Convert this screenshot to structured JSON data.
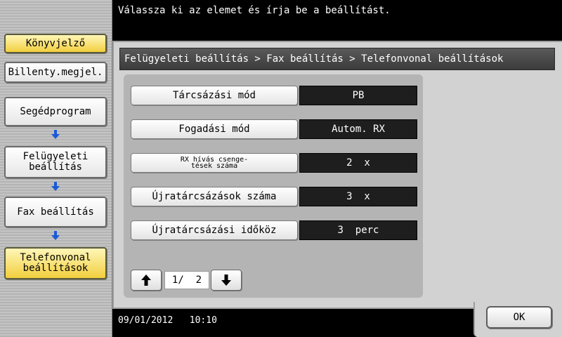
{
  "message": "Válassza ki az elemet és írja be a beállítást.",
  "sidebar": {
    "top_buttons": [
      {
        "label": "Könyvjelző",
        "active": true
      },
      {
        "label": "Billenty.megjel.",
        "active": false
      }
    ],
    "path_steps": [
      {
        "label": "Segédprogram"
      },
      {
        "label_line1": "Felügyeleti",
        "label_line2": "beállítás"
      },
      {
        "label": "Fax beállítás"
      },
      {
        "label_line1": "Telefonvonal",
        "label_line2": "beállítások"
      }
    ]
  },
  "breadcrumb": "Felügyeleti beállítás > Fax beállítás > Telefonvonal beállítások",
  "settings": [
    {
      "label": "Tárcsázási mód",
      "value": "PB"
    },
    {
      "label": "Fogadási mód",
      "value": "Autom. RX"
    },
    {
      "label_line1": "RX hívás csenge-",
      "label_line2": "tések száma",
      "value": "2  x"
    },
    {
      "label": "Újratárcsázások száma",
      "value": "3  x"
    },
    {
      "label": "Újratárcsázási időköz",
      "value": "3  perc"
    }
  ],
  "pager": {
    "indicator": "1/  2"
  },
  "status": {
    "date": "09/01/2012",
    "time": "10:10"
  },
  "ok_label": "OK",
  "colors": {
    "active_step": "#f2cf3e",
    "value_field": "#1e1e1e",
    "arrow_blue": "#1a5ad8"
  },
  "icons": {
    "step_arrow": "arrow-down-icon",
    "page_up": "arrow-up-icon",
    "page_down": "arrow-down-icon"
  }
}
